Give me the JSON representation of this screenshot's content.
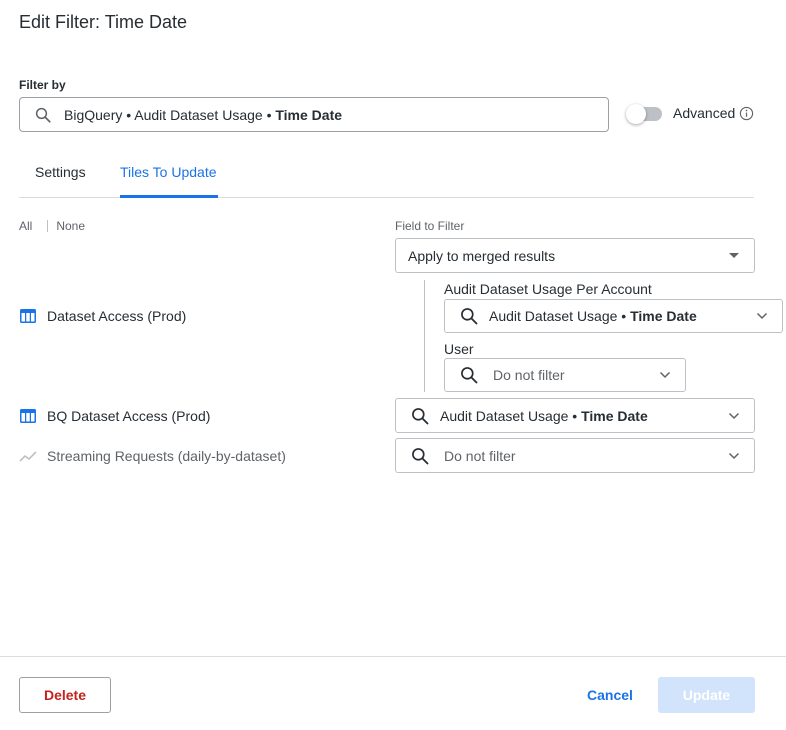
{
  "dialog": {
    "title": "Edit Filter: Time Date"
  },
  "filter_by": {
    "label": "Filter by",
    "value_prefix": "BigQuery • Audit Dataset Usage • ",
    "value_field": "Time Date",
    "icon": "search-icon"
  },
  "advanced": {
    "label": "Advanced",
    "enabled": false,
    "icon": "info-icon"
  },
  "tabs": [
    {
      "label": "Settings",
      "active": false
    },
    {
      "label": "Tiles To Update",
      "active": true
    }
  ],
  "selection": {
    "all": "All",
    "none": "None"
  },
  "field_to_filter": {
    "label": "Field to Filter",
    "merged_value": "Apply to merged results"
  },
  "tiles": [
    {
      "name": "Dataset Access (Prod)",
      "icon": "table-icon",
      "sub_filters": [
        {
          "label": "Audit Dataset Usage Per Account",
          "value_prefix": "Audit Dataset Usage • ",
          "value_field": "Time Date"
        },
        {
          "label": "User",
          "value": "Do not filter"
        }
      ]
    },
    {
      "name": "BQ Dataset Access (Prod)",
      "icon": "table-icon",
      "value_prefix": "Audit Dataset Usage • ",
      "value_field": "Time Date"
    },
    {
      "name": "Streaming Requests (daily-by-dataset)",
      "icon": "line-chart-icon",
      "value": "Do not filter"
    }
  ],
  "footer": {
    "delete": "Delete",
    "cancel": "Cancel",
    "update": "Update"
  },
  "colors": {
    "accent": "#1a73e8",
    "danger": "#c5221f",
    "disabled": "#d2e3fc"
  }
}
